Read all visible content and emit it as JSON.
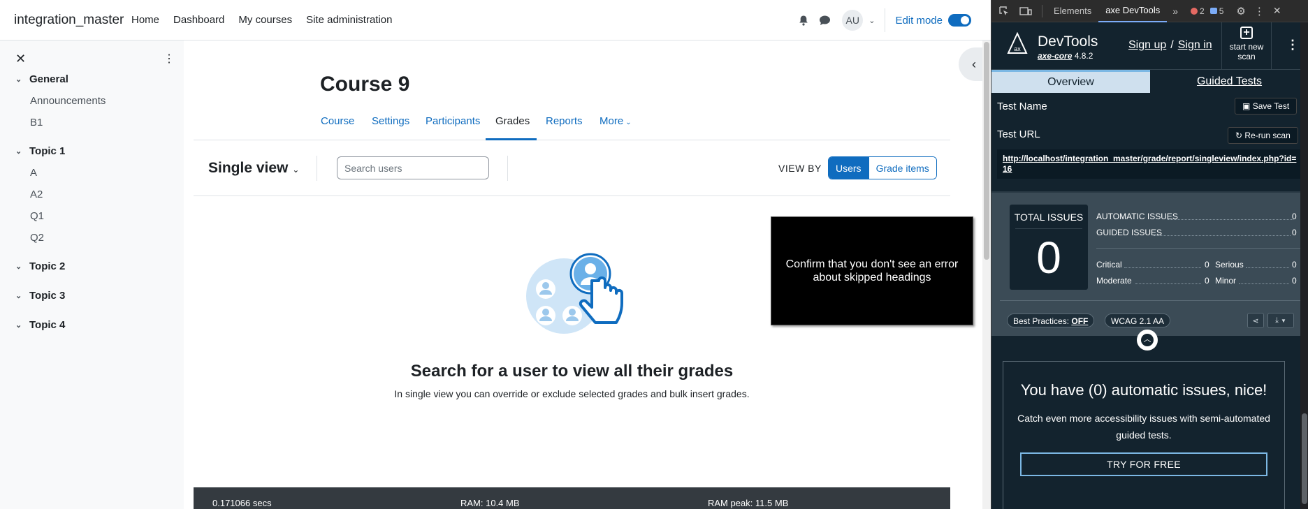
{
  "topbar": {
    "brand": "integration_master",
    "nav": [
      "Home",
      "Dashboard",
      "My courses",
      "Site administration"
    ],
    "avatar": "AU",
    "edit_mode": "Edit mode"
  },
  "drawer": {
    "sections": [
      {
        "title": "General",
        "items": [
          "Announcements",
          "B1"
        ]
      },
      {
        "title": "Topic 1",
        "items": [
          "A",
          "A2",
          "Q1",
          "Q2"
        ]
      },
      {
        "title": "Topic 2",
        "items": []
      },
      {
        "title": "Topic 3",
        "items": []
      },
      {
        "title": "Topic 4",
        "items": []
      }
    ]
  },
  "course": {
    "title": "Course 9",
    "tabs": [
      "Course",
      "Settings",
      "Participants",
      "Grades",
      "Reports",
      "More"
    ],
    "active_tab": "Grades"
  },
  "report": {
    "selector": "Single view",
    "search_placeholder": "Search users",
    "view_by": "VIEW BY",
    "view_options": [
      "Users",
      "Grade items"
    ],
    "selected_view": "Users"
  },
  "empty": {
    "heading": "Search for a user to view all their grades",
    "body": "In single view you can override or exclude selected grades and bulk insert grades."
  },
  "overlay": {
    "text": "Confirm that you don't see an error about skipped headings"
  },
  "footer": {
    "secs": "0.171066 secs",
    "ram": "RAM: 10.4 MB",
    "ram_peak": "RAM peak: 11.5 MB"
  },
  "devtools": {
    "tabs": [
      "Elements",
      "axe DevTools"
    ],
    "active_tab": "axe DevTools",
    "errors": "2",
    "messages": "5"
  },
  "axe": {
    "title": "DevTools",
    "engine": "axe-core",
    "version": "4.8.2",
    "sign_up": "Sign up",
    "slash": "/",
    "sign_in": "Sign in",
    "new_scan": "start new scan",
    "tabs": [
      "Overview",
      "Guided Tests"
    ],
    "test_name_label": "Test Name",
    "save_test": "Save Test",
    "test_url_label": "Test URL",
    "rerun": "Re-run scan",
    "url": "http://localhost/integration_master/grade/report/singleview/index.php?id=16",
    "total_label": "TOTAL ISSUES",
    "total": "0",
    "automatic_label": "AUTOMATIC ISSUES",
    "automatic": "0",
    "guided_label": "GUIDED ISSUES",
    "guided": "0",
    "critical_label": "Critical",
    "critical": "0",
    "serious_label": "Serious",
    "serious": "0",
    "moderate_label": "Moderate",
    "moderate": "0",
    "minor_label": "Minor",
    "minor": "0",
    "best_practices_label": "Best Practices:",
    "best_practices": "OFF",
    "standard": "WCAG 2.1 AA",
    "promo_heading": "You have (0) automatic issues, nice!",
    "promo_body": "Catch even more accessibility issues with semi-automated guided tests.",
    "promo_button": "TRY FOR FREE"
  },
  "colors": {
    "primary": "#0f6cbf",
    "axe_bg": "#13232e",
    "axe_accent": "#7cb8e4"
  }
}
